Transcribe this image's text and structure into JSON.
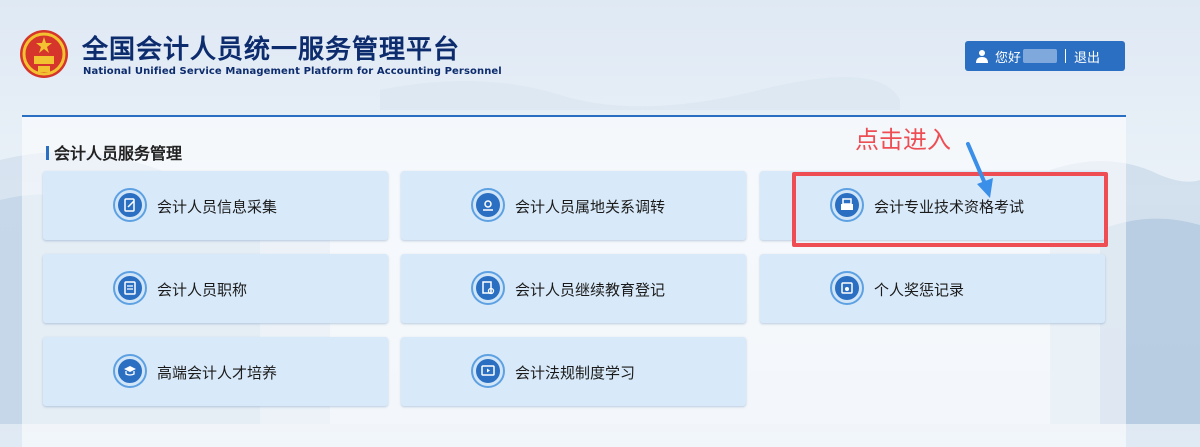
{
  "header": {
    "title_cn": "全国会计人员统一服务管理平台",
    "title_en": "National Unified Service Management Platform for Accounting Personnel",
    "emblem_icon": "national-emblem-icon"
  },
  "user_bar": {
    "greeting": "您好",
    "logout_label": "退出",
    "icon": "user-icon"
  },
  "section": {
    "title": "会计人员服务管理"
  },
  "tiles": [
    {
      "label": "会计人员信息采集",
      "icon": "edit-form-icon"
    },
    {
      "label": "会计人员属地关系调转",
      "icon": "location-transfer-icon"
    },
    {
      "label": "会计专业技术资格考试",
      "icon": "exam-printer-icon"
    },
    {
      "label": "会计人员职称",
      "icon": "document-title-icon"
    },
    {
      "label": "会计人员继续教育登记",
      "icon": "education-register-icon"
    },
    {
      "label": "个人奖惩记录",
      "icon": "reward-record-icon"
    },
    {
      "label": "高端会计人才培养",
      "icon": "graduation-cap-icon"
    },
    {
      "label": "会计法规制度学习",
      "icon": "video-play-icon"
    }
  ],
  "annotation": {
    "text": "点击进入",
    "color": "#ef4d54"
  },
  "colors": {
    "brand_blue": "#2a6fc1",
    "title_navy": "#0d2c6e",
    "tile_bg": "#d8e9f9"
  }
}
